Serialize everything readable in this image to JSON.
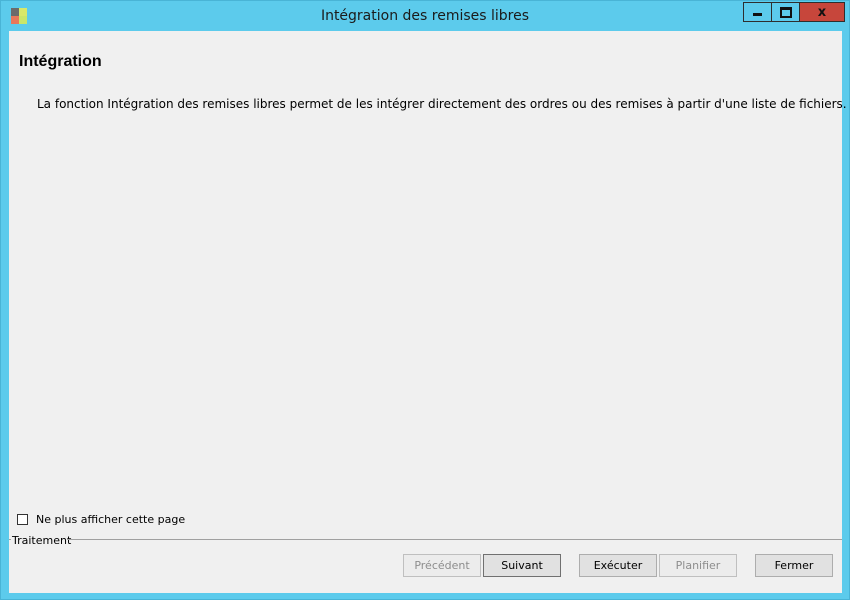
{
  "window": {
    "title": "Intégration des remises libres",
    "colors": {
      "titlebar": "#5ccbec",
      "close": "#c7463b",
      "client": "#f0f0f0"
    },
    "controls": {
      "minimize_icon": "minimize-icon",
      "maximize_icon": "maximize-icon",
      "close_label": "x"
    }
  },
  "page": {
    "heading": "Intégration",
    "description": "La fonction Intégration des remises libres permet de les intégrer directement des ordres ou des remises à partir d'une liste de fichiers."
  },
  "options": {
    "hide_page_label": "Ne plus afficher cette page",
    "hide_page_checked": false
  },
  "footer": {
    "group_label": "Traitement",
    "buttons": {
      "previous": "Précédent",
      "next": "Suivant",
      "execute": "Exécuter",
      "schedule": "Planifier",
      "close": "Fermer"
    }
  }
}
